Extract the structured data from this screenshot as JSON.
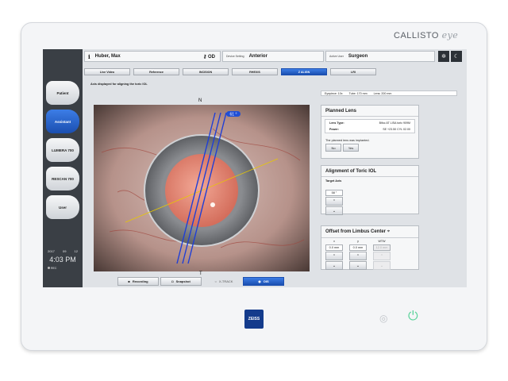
{
  "device": {
    "brand": "CALLISTO",
    "brand_suffix": "eye",
    "logo_text": "ZEISS"
  },
  "header": {
    "patient_name": "Huber, Max",
    "eye": "OD",
    "setting_label": "Device Setting",
    "setting_value": "Anterior",
    "user_label": "Active User",
    "user_value": "Surgeon"
  },
  "sidebar": {
    "items": [
      {
        "label": "Patient",
        "active": false
      },
      {
        "label": "Assistant",
        "active": true
      },
      {
        "label": "LUMERA 700",
        "active": false
      },
      {
        "label": "RESCAN 700",
        "active": false
      },
      {
        "label": "User",
        "active": false
      }
    ],
    "date_year": "2017",
    "date_month": "09",
    "date_day": "12",
    "time": "4:03 PM",
    "rec_label": "REC"
  },
  "tabs": [
    {
      "label": "Live Video",
      "active": false
    },
    {
      "label": "Reference",
      "active": false
    },
    {
      "label": "INCISION",
      "active": false
    },
    {
      "label": "RHEXIS",
      "active": false
    },
    {
      "label": "Z ALIGN",
      "active": true
    },
    {
      "label": "LRI",
      "active": false
    }
  ],
  "message": "Axis displayed for aligning the toric IOL",
  "readout": {
    "eyepiece": "Eyepiece:  10x",
    "tube": "Tube:  170 mm",
    "lens": "Lens:  200 mm"
  },
  "video": {
    "north_label": "N",
    "south_label": "T",
    "axis_badge": "61 °",
    "buttons": {
      "recording": "Recording",
      "snapshot": "Snapshot",
      "xtrack": "X-TRACK",
      "ois": "OIS"
    }
  },
  "planned_lens": {
    "title": "Planned Lens",
    "lens_type_label": "Lens Type:",
    "lens_type_value": "Bifoc AT LISA toric 909M",
    "power_label": "Power:",
    "power_value": "SE +23.50 CYL 02.00",
    "implanted_question": "The planned lens was implanted.",
    "no_label": "No",
    "yes_label": "Yes"
  },
  "alignment": {
    "title": "Alignment of Toric IOL",
    "target_axis_label": "Target Axis",
    "target_axis_value": "58 °"
  },
  "offset": {
    "title": "Offset from Limbus Center",
    "x_label": "x",
    "x_value": "0.0 mm",
    "y_label": "y",
    "y_value": "0.0 mm",
    "wtw_label": "WTW",
    "wtw_value": "12.0 mm"
  },
  "colors": {
    "accent": "#2a63cf",
    "sidebar_bg": "#3a3f45",
    "axis_lines": "#1f3fd6",
    "target_line": "#e8c800"
  }
}
